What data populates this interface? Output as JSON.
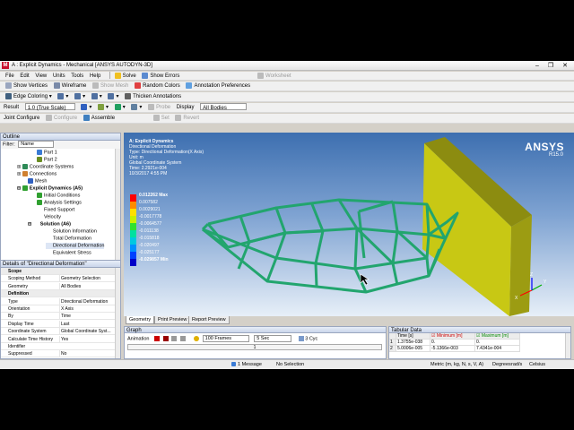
{
  "window": {
    "app_icon": "M",
    "title": "A : Explicit Dynamics - Mechanical [ANSYS AUTODYN-3D]",
    "minimize": "–",
    "restore": "❐",
    "close": "✕"
  },
  "menu": [
    "File",
    "Edit",
    "View",
    "Units",
    "Tools",
    "Help"
  ],
  "toolbar1": {
    "solve": "Solve",
    "show_errors": "Show Errors",
    "worksheet": "Worksheet"
  },
  "toolbar2": {
    "show_vertices": "Show Vertices",
    "wireframe": "Wireframe",
    "show_mesh": "Show Mesh",
    "random_colors": "Random Colors",
    "annotation_prefs": "Annotation Preferences"
  },
  "toolbar3": {
    "edge_coloring": "Edge Coloring",
    "thicken_annotations": "Thicken Annotations"
  },
  "toolbar4": {
    "result_label": "Result",
    "result_scale": "1.0 (True Scale)",
    "probe": "Probe",
    "display_label": "Display",
    "display_value": "All Bodies"
  },
  "toolbar5": {
    "joint_configure": "Joint Configure",
    "configure": "Configure",
    "assemble": "Assemble",
    "set": "Set",
    "revert": "Revert"
  },
  "outline": {
    "title": "Outline",
    "filter_label": "Filter:",
    "filter_value": "Name",
    "nodes": [
      {
        "label": "Part 1",
        "color": "#3a7bd5"
      },
      {
        "label": "Part 2",
        "color": "#3a7bd5"
      },
      {
        "label": "Coordinate Systems",
        "color": "#6b8e23"
      },
      {
        "label": "Connections",
        "color": "#4682b4"
      },
      {
        "label": "Mesh",
        "color": "#2e8b57"
      },
      {
        "label": "Explicit Dynamics (A5)",
        "color": "#e0a030"
      },
      {
        "label": "Initial Conditions",
        "color": "#d08030"
      },
      {
        "label": "Analysis Settings",
        "color": "#4a90d9"
      },
      {
        "label": "Fixed Support",
        "color": "#3060c0"
      },
      {
        "label": "Velocity",
        "color": "#c0a020"
      },
      {
        "label": "Solution (A6)",
        "color": "#30a030"
      },
      {
        "label": "Solution Information",
        "color": "#5a8ad0"
      },
      {
        "label": "Total Deformation",
        "color": "#30a030"
      },
      {
        "label": "Directional Deformation",
        "color": "#30a030"
      },
      {
        "label": "Equivalent Stress",
        "color": "#30a030"
      }
    ]
  },
  "details": {
    "title": "Details of \"Directional Deformation\"",
    "rows": [
      {
        "k": "Scope",
        "v": "",
        "cat": true
      },
      {
        "k": "Scoping Method",
        "v": "Geometry Selection"
      },
      {
        "k": "Geometry",
        "v": "All Bodies"
      },
      {
        "k": "Definition",
        "v": "",
        "cat": true
      },
      {
        "k": "Type",
        "v": "Directional Deformation"
      },
      {
        "k": "Orientation",
        "v": "X Axis"
      },
      {
        "k": "By",
        "v": "Time"
      },
      {
        "k": "Display Time",
        "v": "Last"
      },
      {
        "k": "Coordinate System",
        "v": "Global Coordinate Syst..."
      },
      {
        "k": "Calculate Time History",
        "v": "Yes"
      },
      {
        "k": "Identifier",
        "v": ""
      },
      {
        "k": "Suppressed",
        "v": "No"
      }
    ]
  },
  "viewport": {
    "info": [
      "A: Explicit Dynamics",
      "Directional Deformation",
      "Type: Directional Deformation(X Axis)",
      "Unit: m",
      "Global Coordinate System",
      "Time: 2.2921e-004",
      "10/3/2017 4:55 PM"
    ],
    "brand": "ANSYS",
    "version": "R15.0",
    "legend": [
      {
        "label": "0.012262 Max",
        "color": "#ff0000"
      },
      {
        "label": "0.007582",
        "color": "#ff8c00"
      },
      {
        "label": "0.0029021",
        "color": "#ffe000"
      },
      {
        "label": "-0.0017778",
        "color": "#c8f000"
      },
      {
        "label": "-0.0064577",
        "color": "#30e030"
      },
      {
        "label": "-0.011138",
        "color": "#00e0a0"
      },
      {
        "label": "-0.015818",
        "color": "#00c8e0"
      },
      {
        "label": "-0.020497",
        "color": "#0090ff"
      },
      {
        "label": "-0.025177",
        "color": "#0040ff"
      },
      {
        "label": "-0.029857 Min",
        "color": "#0000c8"
      }
    ],
    "axes": {
      "x": "X",
      "y": "Y",
      "z": "Z"
    }
  },
  "bottom_tabs": [
    "Geometry",
    "Print Preview",
    "Report Preview"
  ],
  "graph": {
    "title": "Graph",
    "animation_label": "Animation",
    "frames": "100 Frames",
    "duration": "5 Sec",
    "cycles": "3 Cyc",
    "slider_value": "1"
  },
  "tabular": {
    "title": "Tabular Data",
    "headers": [
      "Time [s]",
      "Minimum [m]",
      "Maximum [m]"
    ],
    "rows": [
      {
        "idx": "1",
        "time": "1.3755e-038",
        "min": "0.",
        "max": "0."
      },
      {
        "idx": "2",
        "time": "5.0006e-005",
        "min": "-5.1366e-003",
        "max": "7.4341e-004"
      }
    ]
  },
  "status": {
    "messages": "1 Message",
    "selection": "No Selection",
    "units": "Metric (m, kg, N, s, V, A)",
    "angle": "Degrees",
    "rate": "rad/s",
    "temp": "Celsius"
  },
  "colors": {
    "structure": "#22a56e",
    "plate": "#c8c814",
    "accent": "#c8102e"
  }
}
